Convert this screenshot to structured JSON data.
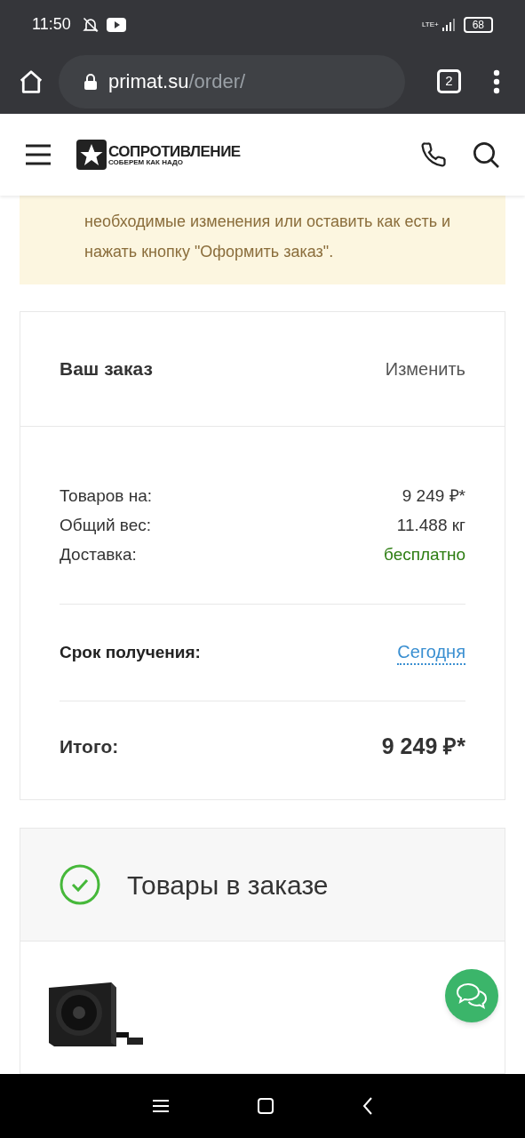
{
  "status_bar": {
    "time": "11:50",
    "network": "LTE+",
    "battery": "68"
  },
  "browser": {
    "url_host": "primat.su",
    "url_path": "/order/",
    "tab_count": "2"
  },
  "site_header": {
    "logo_title": "СОПРОТИВЛЕНИЕ",
    "logo_subtitle": "СОБЕРЕМ КАК НАДО"
  },
  "notice": {
    "lines": [
      "необходимые изменения или оставить как есть и",
      "нажать кнопку \"Оформить заказ\"."
    ]
  },
  "order_summary": {
    "title": "Ваш заказ",
    "edit_link": "Изменить",
    "rows": [
      {
        "label": "Товаров на:",
        "value": "9 249 ₽*",
        "kind": "plain"
      },
      {
        "label": "Общий вес:",
        "value": "11.488 кг",
        "kind": "plain"
      },
      {
        "label": "Доставка:",
        "value": "бесплатно",
        "kind": "free"
      }
    ],
    "delivery_label": "Срок получения:",
    "delivery_value": "Сегодня",
    "total_label": "Итого:",
    "total_value": "9 249 ₽*"
  },
  "items_section": {
    "title": "Товары в заказе",
    "completed": true
  }
}
